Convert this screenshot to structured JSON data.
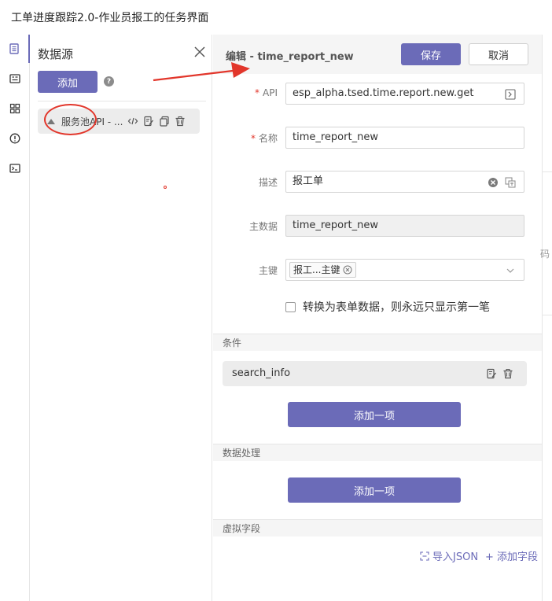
{
  "window_title": "工单进度跟踪2.0-作业员报工的任务界面",
  "rail": [
    "datasource-icon",
    "form-icon",
    "grid-icon",
    "alert-icon",
    "terminal-icon"
  ],
  "datasource": {
    "title": "数据源",
    "add_label": "添加",
    "help": "?",
    "item_label": "服务池API - ..."
  },
  "editor": {
    "title": "编辑 - time_report_new",
    "save_label": "保存",
    "cancel_label": "取消",
    "fields": {
      "api": {
        "label": "API",
        "required": "*",
        "value": "esp_alpha.tsed.time.report.new.get"
      },
      "name": {
        "label": "名称",
        "required": "*",
        "value": "time_report_new"
      },
      "desc": {
        "label": "描述",
        "value": "报工单"
      },
      "master": {
        "label": "主数据",
        "value": "time_report_new"
      },
      "pk": {
        "label": "主键",
        "tag": "报工...主键"
      }
    },
    "checkbox_label": "转换为表单数据，则永远只显示第一笔",
    "sections": {
      "conditions": "条件",
      "processing": "数据处理",
      "virtual": "虚拟字段"
    },
    "condition_item": "search_info",
    "add_item_label": "添加一项",
    "import_json": "导入JSON",
    "add_field": "+ 添加字段"
  },
  "strip_fragment": "码",
  "colors": {
    "accent": "#6b6bb8",
    "annotation": "#e2362b",
    "section_bg": "#f5f5f5"
  }
}
